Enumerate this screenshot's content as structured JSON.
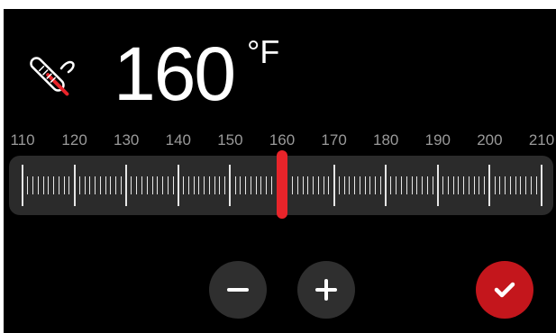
{
  "temperature": {
    "value": "160",
    "unit": "°F"
  },
  "icons": {
    "probe": "thermometer-probe-icon",
    "decrease": "minus-icon",
    "increase": "plus-icon",
    "confirm": "checkmark-icon"
  },
  "slider": {
    "min": 110,
    "max": 210,
    "value": 160,
    "labels": [
      "110",
      "120",
      "130",
      "140",
      "150",
      "160",
      "170",
      "180",
      "190",
      "200",
      "210"
    ]
  },
  "colors": {
    "accent": "#e8242a",
    "confirm": "#c4161c",
    "background": "#000000",
    "track": "#2b2b2b",
    "button": "#2f2f2f"
  }
}
